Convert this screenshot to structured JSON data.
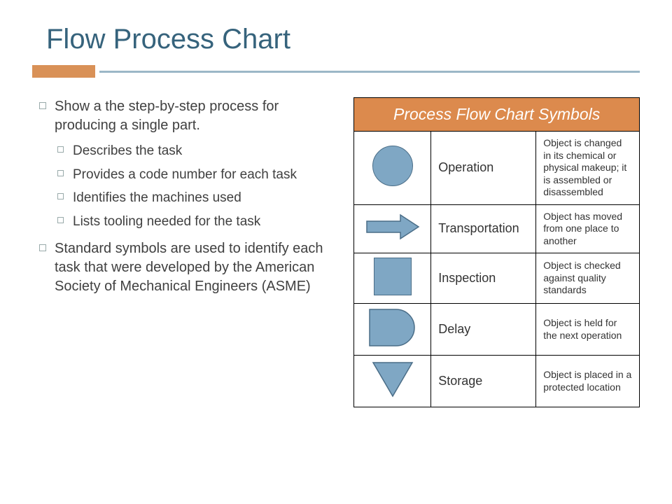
{
  "title": "Flow Process Chart",
  "bullets": {
    "b1": "Show a the step-by-step process for producing a single part.",
    "sub": {
      "s1": "Describes the task",
      "s2": "Provides a code number for each task",
      "s3": "Identifies the machines used",
      "s4": "Lists tooling needed for the task"
    },
    "b2": "Standard symbols are used to identify each task that were developed by the American Society of Mechanical Engineers (ASME)"
  },
  "table": {
    "header": "Process Flow Chart Symbols",
    "rows": [
      {
        "name": "Operation",
        "desc": "Object is changed in its chemical or physical makeup; it is assembled or disassembled"
      },
      {
        "name": "Transportation",
        "desc": "Object has moved from one place to another"
      },
      {
        "name": "Inspection",
        "desc": "Object is checked against quality standards"
      },
      {
        "name": "Delay",
        "desc": "Object is held for the next operation"
      },
      {
        "name": "Storage",
        "desc": "Object is placed in a protected location"
      }
    ]
  }
}
